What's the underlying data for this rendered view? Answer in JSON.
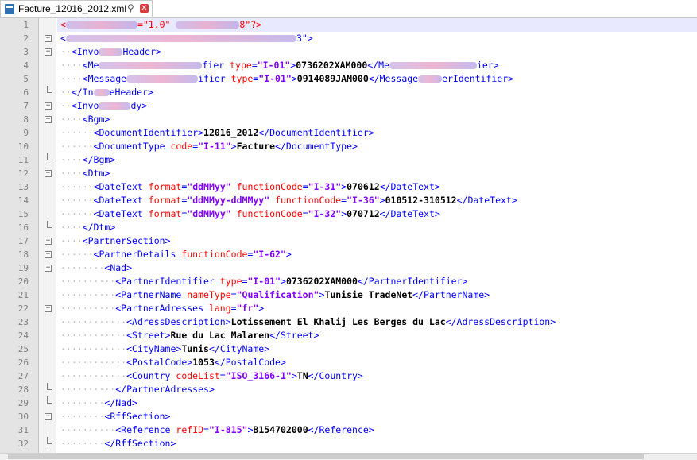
{
  "tab": {
    "filename": "Facture_12016_2012.xml",
    "pin_glyph": "⚲",
    "close_glyph": "✕"
  },
  "lines": [
    {
      "n": "1",
      "indent": 0,
      "fold": "none",
      "tokens": [
        {
          "t": "decl",
          "v": "<"
        },
        {
          "t": "redact",
          "w": 90
        },
        {
          "t": "decl",
          "v": "=\"1.0\" "
        },
        {
          "t": "redact",
          "w": 80
        },
        {
          "t": "decl",
          "v": "8\"?>"
        }
      ]
    },
    {
      "n": "2",
      "indent": 0,
      "fold": "open",
      "tokens": [
        {
          "t": "tag",
          "v": "<"
        },
        {
          "t": "redact",
          "w": 290
        },
        {
          "t": "tag",
          "v": "3\">"
        }
      ]
    },
    {
      "n": "3",
      "indent": 1,
      "fold": "open",
      "tokens": [
        {
          "t": "tag",
          "v": "<Invo"
        },
        {
          "t": "redact",
          "w": 30
        },
        {
          "t": "tag",
          "v": "Header>"
        }
      ]
    },
    {
      "n": "4",
      "indent": 2,
      "fold": "none",
      "tokens": [
        {
          "t": "tag",
          "v": "<Me"
        },
        {
          "t": "redact",
          "w": 130
        },
        {
          "t": "tag",
          "v": "fier "
        },
        {
          "t": "attr",
          "v": "type"
        },
        {
          "t": "tag",
          "v": "="
        },
        {
          "t": "val",
          "v": "\"I-01\""
        },
        {
          "t": "tag",
          "v": ">"
        },
        {
          "t": "text",
          "v": "0736202XAM000"
        },
        {
          "t": "tag",
          "v": "</Me"
        },
        {
          "t": "redact",
          "w": 110
        },
        {
          "t": "tag",
          "v": "ier>"
        }
      ]
    },
    {
      "n": "5",
      "indent": 2,
      "fold": "none",
      "tokens": [
        {
          "t": "tag",
          "v": "<Message"
        },
        {
          "t": "redact",
          "w": 90
        },
        {
          "t": "tag",
          "v": "ifier "
        },
        {
          "t": "attr",
          "v": "type"
        },
        {
          "t": "tag",
          "v": "="
        },
        {
          "t": "val",
          "v": "\"I-01\""
        },
        {
          "t": "tag",
          "v": ">"
        },
        {
          "t": "text",
          "v": "0914089JAM000"
        },
        {
          "t": "tag",
          "v": "</Message"
        },
        {
          "t": "redact",
          "w": 30
        },
        {
          "t": "tag",
          "v": "erIdentifier>"
        }
      ]
    },
    {
      "n": "6",
      "indent": 1,
      "fold": "end",
      "tokens": [
        {
          "t": "tag",
          "v": "</In"
        },
        {
          "t": "redact",
          "w": 20
        },
        {
          "t": "tag",
          "v": "eHeader>"
        }
      ]
    },
    {
      "n": "7",
      "indent": 1,
      "fold": "open",
      "tokens": [
        {
          "t": "tag",
          "v": "<Invo"
        },
        {
          "t": "redact",
          "w": 40
        },
        {
          "t": "tag",
          "v": "dy>"
        }
      ]
    },
    {
      "n": "8",
      "indent": 2,
      "fold": "open",
      "tokens": [
        {
          "t": "tag",
          "v": "<Bgm>"
        }
      ]
    },
    {
      "n": "9",
      "indent": 3,
      "fold": "none",
      "tokens": [
        {
          "t": "tag",
          "v": "<DocumentIdentifier>"
        },
        {
          "t": "text",
          "v": "12016_2012"
        },
        {
          "t": "tag",
          "v": "</DocumentIdentifier>"
        }
      ]
    },
    {
      "n": "10",
      "indent": 3,
      "fold": "none",
      "tokens": [
        {
          "t": "tag",
          "v": "<DocumentType "
        },
        {
          "t": "attr",
          "v": "code"
        },
        {
          "t": "tag",
          "v": "="
        },
        {
          "t": "val",
          "v": "\"I-11\""
        },
        {
          "t": "tag",
          "v": ">"
        },
        {
          "t": "text",
          "v": "Facture"
        },
        {
          "t": "tag",
          "v": "</DocumentType>"
        }
      ]
    },
    {
      "n": "11",
      "indent": 2,
      "fold": "end",
      "tokens": [
        {
          "t": "tag",
          "v": "</Bgm>"
        }
      ]
    },
    {
      "n": "12",
      "indent": 2,
      "fold": "open",
      "tokens": [
        {
          "t": "tag",
          "v": "<Dtm>"
        }
      ]
    },
    {
      "n": "13",
      "indent": 3,
      "fold": "none",
      "tokens": [
        {
          "t": "tag",
          "v": "<DateText "
        },
        {
          "t": "attr",
          "v": "format"
        },
        {
          "t": "tag",
          "v": "="
        },
        {
          "t": "val",
          "v": "\"ddMMyy\""
        },
        {
          "t": "tag",
          "v": " "
        },
        {
          "t": "attr",
          "v": "functionCode"
        },
        {
          "t": "tag",
          "v": "="
        },
        {
          "t": "val",
          "v": "\"I-31\""
        },
        {
          "t": "tag",
          "v": ">"
        },
        {
          "t": "text",
          "v": "070612"
        },
        {
          "t": "tag",
          "v": "</DateText>"
        }
      ]
    },
    {
      "n": "14",
      "indent": 3,
      "fold": "none",
      "tokens": [
        {
          "t": "tag",
          "v": "<DateText "
        },
        {
          "t": "attr",
          "v": "format"
        },
        {
          "t": "tag",
          "v": "="
        },
        {
          "t": "val",
          "v": "\"ddMMyy-ddMMyy\""
        },
        {
          "t": "tag",
          "v": " "
        },
        {
          "t": "attr",
          "v": "functionCode"
        },
        {
          "t": "tag",
          "v": "="
        },
        {
          "t": "val",
          "v": "\"I-36\""
        },
        {
          "t": "tag",
          "v": ">"
        },
        {
          "t": "text",
          "v": "010512-310512"
        },
        {
          "t": "tag",
          "v": "</DateText>"
        }
      ]
    },
    {
      "n": "15",
      "indent": 3,
      "fold": "none",
      "tokens": [
        {
          "t": "tag",
          "v": "<DateText "
        },
        {
          "t": "attr",
          "v": "format"
        },
        {
          "t": "tag",
          "v": "="
        },
        {
          "t": "val",
          "v": "\"ddMMyy\""
        },
        {
          "t": "tag",
          "v": " "
        },
        {
          "t": "attr",
          "v": "functionCode"
        },
        {
          "t": "tag",
          "v": "="
        },
        {
          "t": "val",
          "v": "\"I-32\""
        },
        {
          "t": "tag",
          "v": ">"
        },
        {
          "t": "text",
          "v": "070712"
        },
        {
          "t": "tag",
          "v": "</DateText>"
        }
      ]
    },
    {
      "n": "16",
      "indent": 2,
      "fold": "end",
      "tokens": [
        {
          "t": "tag",
          "v": "</Dtm>"
        }
      ]
    },
    {
      "n": "17",
      "indent": 2,
      "fold": "open",
      "tokens": [
        {
          "t": "tag",
          "v": "<PartnerSection>"
        }
      ]
    },
    {
      "n": "18",
      "indent": 3,
      "fold": "open",
      "tokens": [
        {
          "t": "tag",
          "v": "<PartnerDetails "
        },
        {
          "t": "attr",
          "v": "functionCode"
        },
        {
          "t": "tag",
          "v": "="
        },
        {
          "t": "val",
          "v": "\"I-62\""
        },
        {
          "t": "tag",
          "v": ">"
        }
      ]
    },
    {
      "n": "19",
      "indent": 4,
      "fold": "open",
      "tokens": [
        {
          "t": "tag",
          "v": "<Nad>"
        }
      ]
    },
    {
      "n": "20",
      "indent": 5,
      "fold": "none",
      "tokens": [
        {
          "t": "tag",
          "v": "<PartnerIdentifier "
        },
        {
          "t": "attr",
          "v": "type"
        },
        {
          "t": "tag",
          "v": "="
        },
        {
          "t": "val",
          "v": "\"I-01\""
        },
        {
          "t": "tag",
          "v": ">"
        },
        {
          "t": "text",
          "v": "0736202XAM000"
        },
        {
          "t": "tag",
          "v": "</PartnerIdentifier>"
        }
      ]
    },
    {
      "n": "21",
      "indent": 5,
      "fold": "none",
      "tokens": [
        {
          "t": "tag",
          "v": "<PartnerName "
        },
        {
          "t": "attr",
          "v": "nameType"
        },
        {
          "t": "tag",
          "v": "="
        },
        {
          "t": "val",
          "v": "\"Qualification\""
        },
        {
          "t": "tag",
          "v": ">"
        },
        {
          "t": "text",
          "v": "Tunisie TradeNet"
        },
        {
          "t": "tag",
          "v": "</PartnerName>"
        }
      ]
    },
    {
      "n": "22",
      "indent": 5,
      "fold": "open",
      "tokens": [
        {
          "t": "tag",
          "v": "<PartnerAdresses "
        },
        {
          "t": "attr",
          "v": "lang"
        },
        {
          "t": "tag",
          "v": "="
        },
        {
          "t": "val",
          "v": "\"fr\""
        },
        {
          "t": "tag",
          "v": ">"
        }
      ]
    },
    {
      "n": "23",
      "indent": 6,
      "fold": "none",
      "tokens": [
        {
          "t": "tag",
          "v": "<AdressDescription>"
        },
        {
          "t": "text",
          "v": "Lotissement El Khalij Les Berges du Lac"
        },
        {
          "t": "tag",
          "v": "</AdressDescription>"
        }
      ]
    },
    {
      "n": "24",
      "indent": 6,
      "fold": "none",
      "tokens": [
        {
          "t": "tag",
          "v": "<Street>"
        },
        {
          "t": "text",
          "v": "Rue du Lac Malaren"
        },
        {
          "t": "tag",
          "v": "</Street>"
        }
      ]
    },
    {
      "n": "25",
      "indent": 6,
      "fold": "none",
      "tokens": [
        {
          "t": "tag",
          "v": "<CityName>"
        },
        {
          "t": "text",
          "v": "Tunis"
        },
        {
          "t": "tag",
          "v": "</CityName>"
        }
      ]
    },
    {
      "n": "26",
      "indent": 6,
      "fold": "none",
      "tokens": [
        {
          "t": "tag",
          "v": "<PostalCode>"
        },
        {
          "t": "text",
          "v": "1053"
        },
        {
          "t": "tag",
          "v": "</PostalCode>"
        }
      ]
    },
    {
      "n": "27",
      "indent": 6,
      "fold": "none",
      "tokens": [
        {
          "t": "tag",
          "v": "<Country "
        },
        {
          "t": "attr",
          "v": "codeList"
        },
        {
          "t": "tag",
          "v": "="
        },
        {
          "t": "val",
          "v": "\"ISO_3166-1\""
        },
        {
          "t": "tag",
          "v": ">"
        },
        {
          "t": "text",
          "v": "TN"
        },
        {
          "t": "tag",
          "v": "</Country>"
        }
      ]
    },
    {
      "n": "28",
      "indent": 5,
      "fold": "end",
      "tokens": [
        {
          "t": "tag",
          "v": "</PartnerAdresses>"
        }
      ]
    },
    {
      "n": "29",
      "indent": 4,
      "fold": "end",
      "tokens": [
        {
          "t": "tag",
          "v": "</Nad>"
        }
      ]
    },
    {
      "n": "30",
      "indent": 4,
      "fold": "open",
      "tokens": [
        {
          "t": "tag",
          "v": "<RffSection>"
        }
      ]
    },
    {
      "n": "31",
      "indent": 5,
      "fold": "none",
      "tokens": [
        {
          "t": "tag",
          "v": "<Reference "
        },
        {
          "t": "attr",
          "v": "refID"
        },
        {
          "t": "tag",
          "v": "="
        },
        {
          "t": "val",
          "v": "\"I-815\""
        },
        {
          "t": "tag",
          "v": ">"
        },
        {
          "t": "text",
          "v": "B154702000"
        },
        {
          "t": "tag",
          "v": "</Reference>"
        }
      ]
    },
    {
      "n": "32",
      "indent": 4,
      "fold": "end",
      "tokens": [
        {
          "t": "tag",
          "v": "</RffSection>"
        }
      ]
    }
  ]
}
